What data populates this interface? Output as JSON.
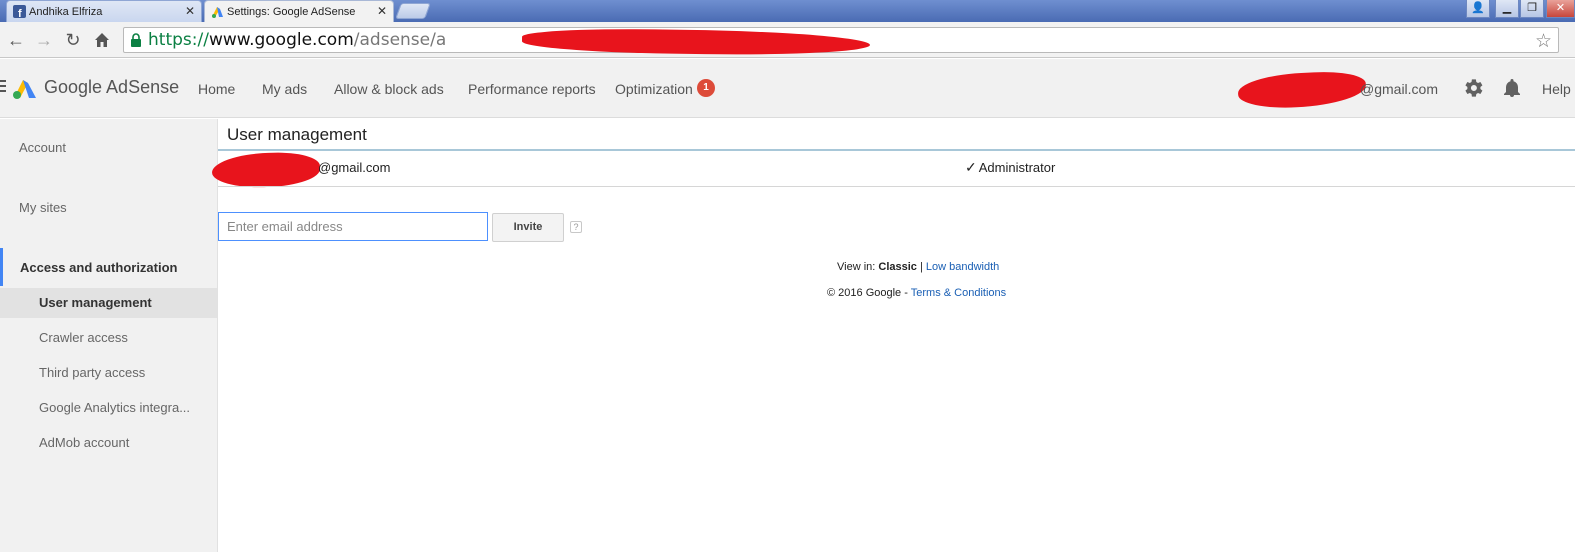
{
  "browser": {
    "tabs": [
      {
        "title": "Andhika Elfriza"
      },
      {
        "title": "Settings: Google AdSense"
      }
    ],
    "url": {
      "scheme": "https://",
      "host": "www.google.com",
      "path": "/adsense/a"
    }
  },
  "header": {
    "brand": "Google AdSense",
    "nav": [
      "Home",
      "My ads",
      "Allow & block ads",
      "Performance reports",
      "Optimization"
    ],
    "optimization_badge": "1",
    "account_email_suffix": "@gmail.com",
    "help": "Help"
  },
  "sidebar": {
    "items": [
      "Account",
      "My sites"
    ],
    "section": "Access and authorization",
    "subitems": [
      "User management",
      "Crawler access",
      "Third party access",
      "Google Analytics integra...",
      "AdMob account"
    ]
  },
  "main": {
    "title": "User management",
    "user_email_suffix": "@gmail.com",
    "role": "Administrator",
    "invite_placeholder": "Enter email address",
    "invite_button": "Invite",
    "help_mark": "?"
  },
  "footer": {
    "view_in_label": "View in:",
    "view_classic": "Classic",
    "separator": "|",
    "view_low_bandwidth": "Low bandwidth",
    "copyright": "© 2016 Google -",
    "terms": "Terms & Conditions"
  },
  "colors": {
    "accent_blue": "#4285f4",
    "badge_red": "#dd4b39",
    "redaction_red": "#e8141c"
  }
}
